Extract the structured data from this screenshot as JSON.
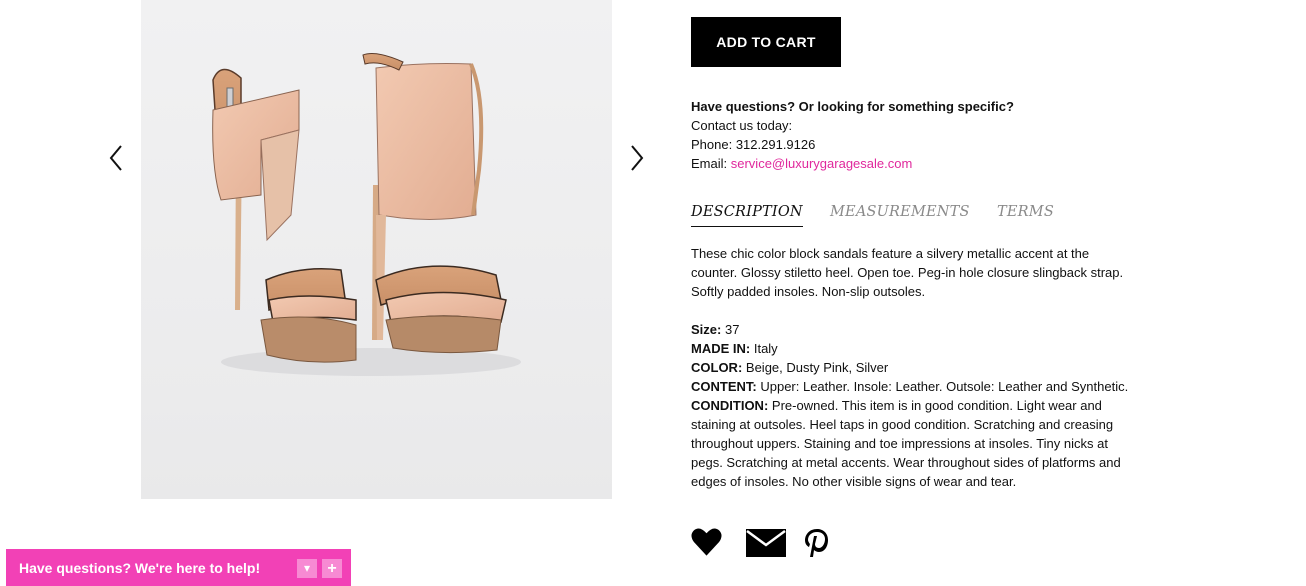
{
  "product": {
    "image_alt": "Beige and dusty pink leather color block high heel sandals"
  },
  "actions": {
    "add_to_cart": "ADD TO CART"
  },
  "contact": {
    "question": "Have questions? Or looking for something specific?",
    "contact_line": "Contact us today:",
    "phone_label": "Phone:",
    "phone": "312.291.9126",
    "email_label": "Email:",
    "email": "service@luxurygaragesale.com"
  },
  "tabs": {
    "description": "DESCRIPTION",
    "measurements": "MEASUREMENTS",
    "terms": "TERMS",
    "active": "DESCRIPTION"
  },
  "description": {
    "intro": "These chic color block sandals feature a silvery metallic accent at the counter. Glossy stiletto heel. Open toe. Peg-in hole closure slingback strap. Softly padded insoles. Non-slip outsoles.",
    "size_label": "Size:",
    "size": "37",
    "made_in_label": "MADE IN:",
    "made_in": "Italy",
    "color_label": "COLOR:",
    "color": "Beige, Dusty Pink, Silver",
    "content_label": "CONTENT:",
    "content": "Upper: Leather. Insole: Leather. Outsole: Leather and Synthetic.",
    "condition_label": "CONDITION:",
    "condition": "Pre-owned. This item is in good condition. Light wear and staining at outsoles. Heel taps in good condition. Scratching and creasing throughout uppers. Staining and toe impressions at insoles. Tiny nicks at pegs. Scratching at metal accents. Wear throughout sides of platforms and edges of insoles. No other visible signs of wear and tear."
  },
  "chat": {
    "text": "Have questions? We're here to help!",
    "minimize": "▾",
    "expand": "+"
  },
  "colors": {
    "accent_pink": "#f241b6",
    "link_pink": "#e0289c",
    "button_black": "#000000",
    "inactive_tab": "#8a8a8a"
  },
  "icons": [
    "chevron-left-icon",
    "chevron-right-icon",
    "heart-icon",
    "envelope-icon",
    "pinterest-icon"
  ]
}
